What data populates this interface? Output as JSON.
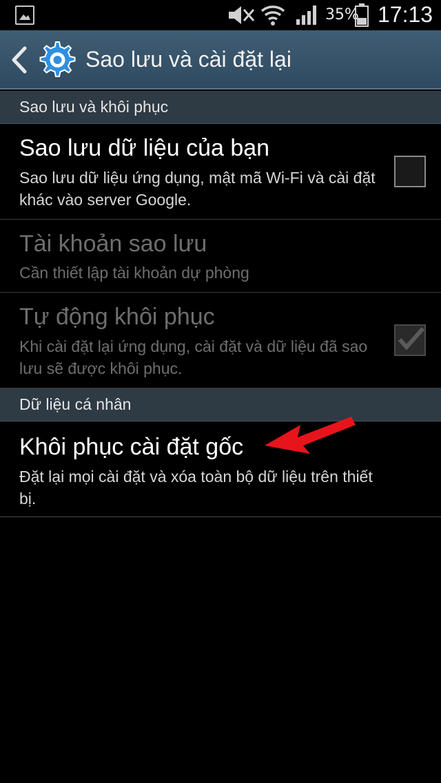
{
  "status_bar": {
    "battery_percent": "35%",
    "time": "17:13",
    "icons": [
      "gallery-icon",
      "mute-icon",
      "wifi-icon",
      "signal-icon",
      "battery-icon"
    ]
  },
  "action_bar": {
    "title": "Sao lưu và cài đặt lại",
    "icons": [
      "back-arrow-icon",
      "settings-gear-icon"
    ],
    "accent_color": "#2f8fe0"
  },
  "sections": [
    {
      "header": "Sao lưu và khôi phục",
      "items": [
        {
          "title": "Sao lưu dữ liệu của bạn",
          "subtitle": "Sao lưu dữ liệu ứng dụng, mật mã Wi-Fi và cài đặt khác vào server Google.",
          "enabled": true,
          "checkbox": "unchecked"
        },
        {
          "title": "Tài khoản sao lưu",
          "subtitle": "Cần thiết lập tài khoản dự phòng",
          "enabled": false
        },
        {
          "title": "Tự động khôi phục",
          "subtitle": "Khi cài đặt lại ứng dụng, cài đặt và dữ liệu đã sao lưu sẽ được khôi phục.",
          "enabled": false,
          "checkbox": "checked"
        }
      ]
    },
    {
      "header": "Dữ liệu cá nhân",
      "items": [
        {
          "title": "Khôi phục cài đặt gốc",
          "subtitle": "Đặt lại mọi cài đặt và xóa toàn bộ dữ liệu trên thiết bị.",
          "enabled": true
        }
      ]
    }
  ],
  "annotation": {
    "arrow_color": "#e8141b"
  }
}
